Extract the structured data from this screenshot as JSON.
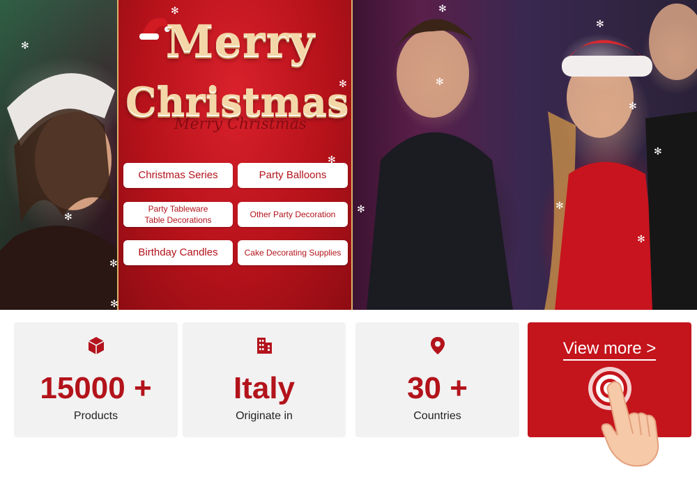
{
  "hero": {
    "title_line1": "Merry",
    "title_line2": "Christmas",
    "title_script": "Merry Christmas",
    "categories": [
      {
        "label": "Christmas Series"
      },
      {
        "label": "Party Balloons"
      },
      {
        "label": "Party Tableware\nTable Decorations"
      },
      {
        "label": "Other Party Decoration"
      },
      {
        "label": "Birthday Candles"
      },
      {
        "label": "Cake Decorating Supplies"
      }
    ]
  },
  "stats": [
    {
      "icon": "box-icon",
      "value": "15000 +",
      "label": "Products"
    },
    {
      "icon": "building-icon",
      "value": "Italy",
      "label": "Originate in"
    },
    {
      "icon": "location-pin-icon",
      "value": "30 +",
      "label": "Countries"
    }
  ],
  "cta": {
    "label": "View more >",
    "icon": "pointing-hand-icon"
  },
  "colors": {
    "brand_red": "#c4141c",
    "text_red": "#b3131b",
    "gold": "#f3d7a8",
    "card_bg": "#f2f2f2"
  }
}
